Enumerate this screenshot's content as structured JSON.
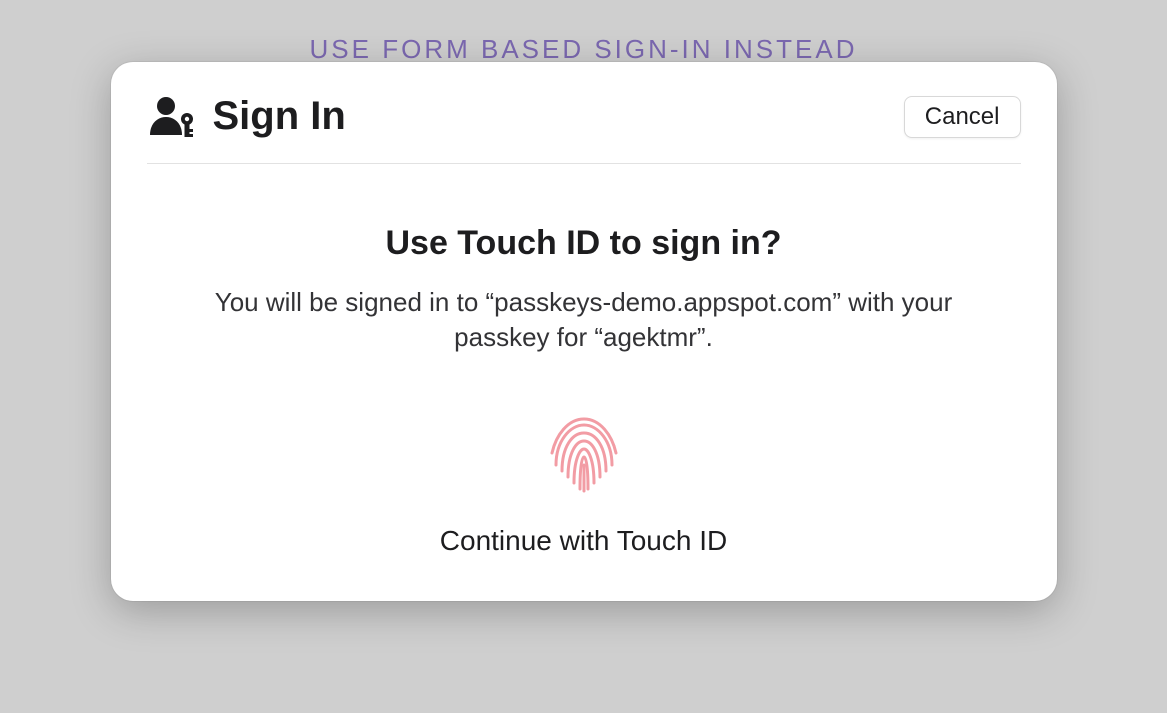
{
  "background": {
    "link_text": "USE FORM BASED SIGN-IN INSTEAD"
  },
  "dialog": {
    "title": "Sign In",
    "cancel_label": "Cancel",
    "heading": "Use Touch ID to sign in?",
    "description": "You will be signed in to “passkeys-demo.appspot.com” with your passkey for “agektmr”.",
    "continue_label": "Continue with Touch ID"
  },
  "colors": {
    "link": "#7B68B0",
    "fingerprint": "#f29ca4"
  }
}
